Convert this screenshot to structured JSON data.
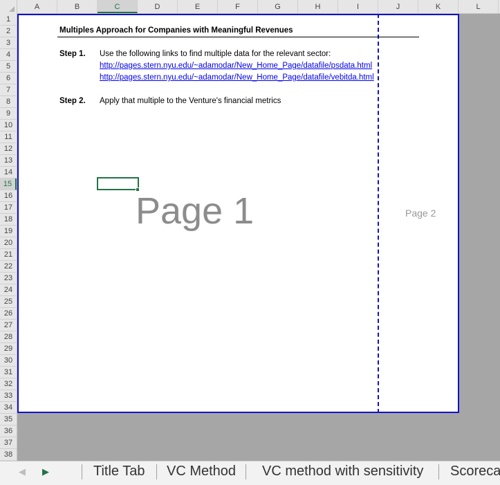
{
  "columns": [
    "A",
    "B",
    "C",
    "D",
    "E",
    "F",
    "G",
    "H",
    "I",
    "J",
    "K",
    "L"
  ],
  "selected_column": "C",
  "rows": [
    "1",
    "2",
    "3",
    "4",
    "5",
    "6",
    "7",
    "8",
    "9",
    "10",
    "11",
    "12",
    "13",
    "14",
    "15",
    "16",
    "17",
    "18",
    "19",
    "20",
    "21",
    "22",
    "23",
    "24",
    "25",
    "26",
    "27",
    "28",
    "29",
    "30",
    "31",
    "32",
    "33",
    "34",
    "35",
    "36",
    "37",
    "38"
  ],
  "selected_row": "15",
  "sheet": {
    "title": "Multiples Approach for Companies with Meaningful Revenues",
    "step1_label": "Step 1.",
    "step1_text": "Use the following links to find multiple data for the relevant sector:",
    "link1": "http://pages.stern.nyu.edu/~adamodar/New_Home_Page/datafile/psdata.html",
    "link2": "http://pages.stern.nyu.edu/~adamodar/New_Home_Page/datafile/vebitda.html",
    "step2_label": "Step 2.",
    "step2_text": "Apply that multiple to the Venture's financial metrics"
  },
  "watermarks": {
    "page1": "Page 1",
    "page2": "Page 2"
  },
  "tabs": [
    "Title Tab",
    "VC Method",
    "VC method with sensitivity",
    "Scorecard"
  ],
  "icons": {
    "prev": "triangle-left-icon",
    "next": "triangle-right-icon"
  },
  "colors": {
    "accent": "#217346",
    "page_border": "#1010c8",
    "link": "#0000ee",
    "watermark": "#8c8c8c"
  }
}
